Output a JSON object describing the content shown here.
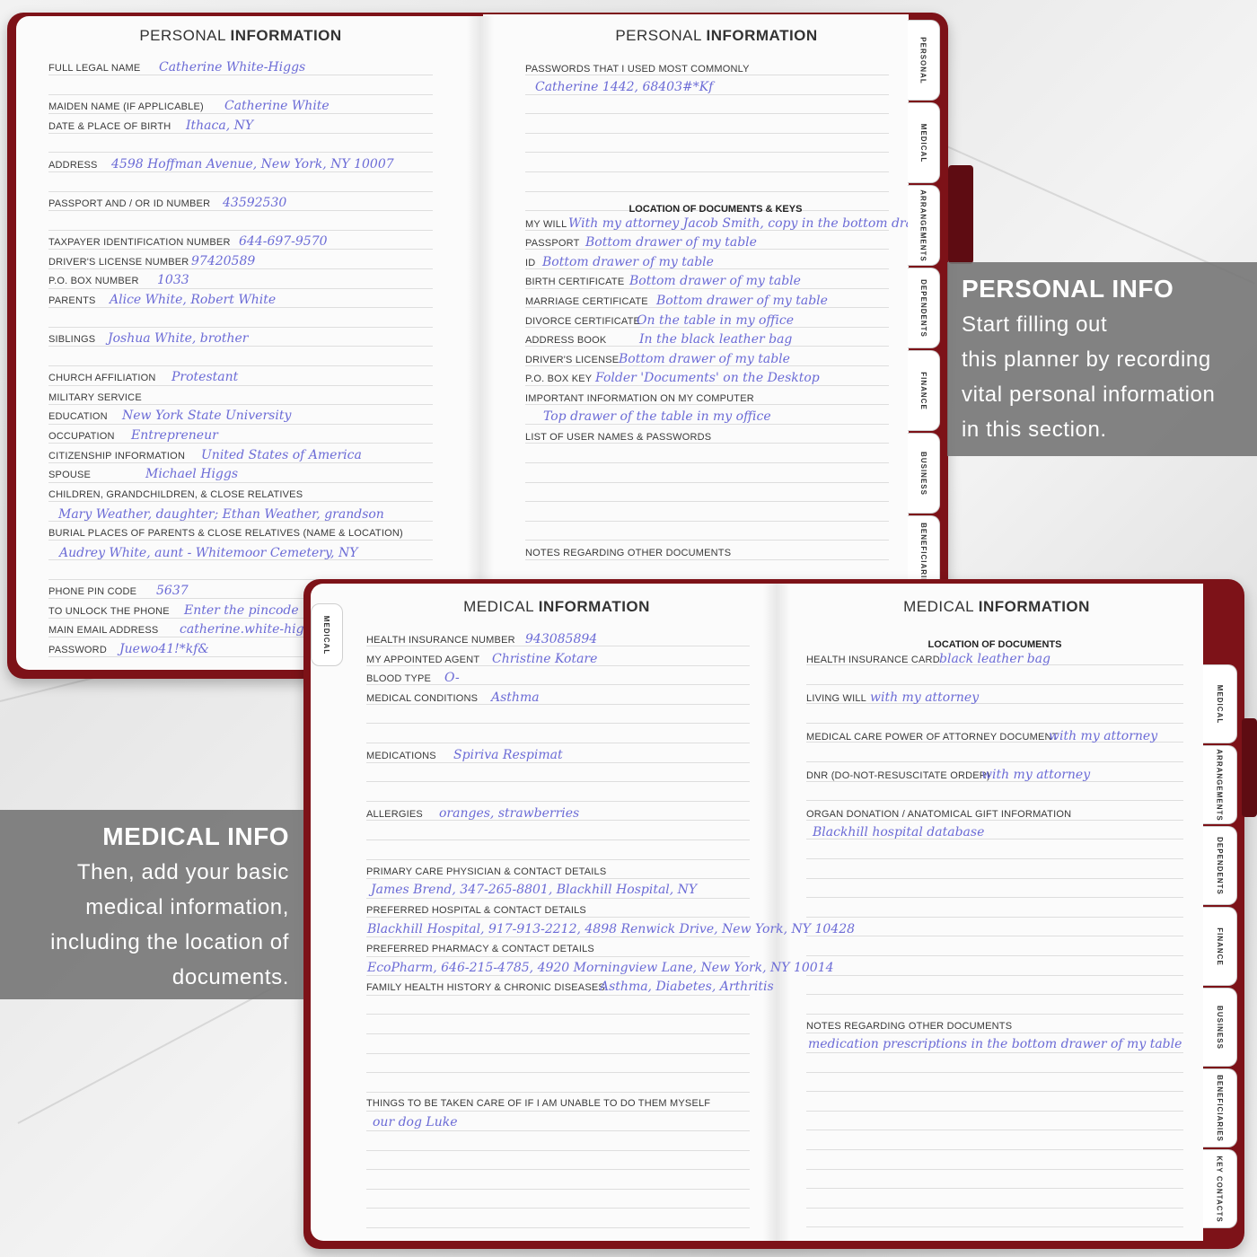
{
  "personal": {
    "title_light": "PERSONAL",
    "title_bold": "INFORMATION",
    "left_rows": [
      {
        "label": "FULL LEGAL NAME",
        "value": "Catherine White-Higgs"
      },
      {
        "label": "MAIDEN NAME (IF APPLICABLE)",
        "value": "Catherine White"
      },
      {
        "label": "DATE & PLACE OF BIRTH",
        "value": "Ithaca, NY"
      },
      {
        "label": "ADDRESS",
        "value": "4598 Hoffman Avenue, New York, NY 10007"
      },
      {
        "label": "PASSPORT AND / OR ID NUMBER",
        "value": "43592530"
      },
      {
        "label": "TAXPAYER IDENTIFICATION NUMBER",
        "value": "644-697-9570"
      },
      {
        "label": "DRIVER'S LICENSE NUMBER",
        "value": "97420589"
      },
      {
        "label": "P.O. BOX NUMBER",
        "value": "1033"
      },
      {
        "label": "PARENTS",
        "value": "Alice White, Robert White"
      },
      {
        "label": "SIBLINGS",
        "value": "Joshua White, brother"
      },
      {
        "label": "CHURCH AFFILIATION",
        "value": "Protestant"
      },
      {
        "label": "MILITARY SERVICE",
        "value": ""
      },
      {
        "label": "EDUCATION",
        "value": "New York State University"
      },
      {
        "label": "OCCUPATION",
        "value": "Entrepreneur"
      },
      {
        "label": "CITIZENSHIP INFORMATION",
        "value": "United States of America"
      },
      {
        "label": "SPOUSE",
        "value": "Michael Higgs"
      },
      {
        "label": "CHILDREN, GRANDCHILDREN, & CLOSE RELATIVES",
        "value": "Mary Weather, daughter; Ethan Weather, grandson"
      },
      {
        "label": "BURIAL PLACES OF PARENTS & CLOSE RELATIVES (NAME & LOCATION)",
        "value": "Audrey White, aunt - Whitemoor Cemetery, NY"
      },
      {
        "label": "PHONE PIN CODE",
        "value": "5637"
      },
      {
        "label": "TO UNLOCK THE PHONE",
        "value": "Enter the pincode"
      },
      {
        "label": "MAIN EMAIL ADDRESS",
        "value": "catherine.white-higgs@"
      },
      {
        "label": "PASSWORD",
        "value": "Juewo41!*kf&"
      }
    ],
    "right_rows": [
      {
        "label": "PASSWORDS THAT I USED MOST COMMONLY",
        "value": "Catherine 1442, 68403#*Kf"
      },
      {
        "label": "MY WILL",
        "value": "With my attorney Jacob Smith, copy in the bottom drawer"
      },
      {
        "label": "PASSPORT",
        "value": "Bottom drawer of my table"
      },
      {
        "label": "ID",
        "value": "Bottom drawer of my table"
      },
      {
        "label": "BIRTH CERTIFICATE",
        "value": "Bottom drawer of my table"
      },
      {
        "label": "MARRIAGE CERTIFICATE",
        "value": "Bottom drawer of my table"
      },
      {
        "label": "DIVORCE CERTIFICATE",
        "value": "On the table in my office"
      },
      {
        "label": "ADDRESS BOOK",
        "value": "In the black leather bag"
      },
      {
        "label": "DRIVER'S LICENSE",
        "value": "Bottom drawer of my table"
      },
      {
        "label": "P.O. BOX KEY",
        "value": "Folder 'Documents' on the Desktop"
      },
      {
        "label": "IMPORTANT INFORMATION ON MY COMPUTER",
        "value": "Top drawer of the table in my office"
      },
      {
        "label": "LIST OF USER NAMES & PASSWORDS",
        "value": ""
      },
      {
        "label": "NOTES REGARDING OTHER DOCUMENTS",
        "value": ""
      }
    ],
    "right_subheading": "LOCATION OF DOCUMENTS & KEYS",
    "tabs": [
      "PERSONAL",
      "MEDICAL",
      "ARRANGEMENTS",
      "DEPENDENTS",
      "FINANCE",
      "BUSINESS",
      "BENEFICIARIES"
    ]
  },
  "medical": {
    "title_light": "MEDICAL",
    "title_bold": "INFORMATION",
    "left_tab": "MEDICAL",
    "left_rows": [
      {
        "label": "HEALTH INSURANCE NUMBER",
        "value": "943085894"
      },
      {
        "label": "MY APPOINTED AGENT",
        "value": "Christine Kotare"
      },
      {
        "label": "BLOOD TYPE",
        "value": "O-"
      },
      {
        "label": "MEDICAL CONDITIONS",
        "value": "Asthma"
      },
      {
        "label": "MEDICATIONS",
        "value": "Spiriva Respimat"
      },
      {
        "label": "ALLERGIES",
        "value": "oranges, strawberries"
      },
      {
        "label": "PRIMARY CARE PHYSICIAN & CONTACT DETAILS",
        "value": "James Brend, 347-265-8801, Blackhill Hospital, NY"
      },
      {
        "label": "PREFERRED HOSPITAL & CONTACT DETAILS",
        "value": "Blackhill Hospital, 917-913-2212, 4898 Renwick Drive, New York, NY 10428"
      },
      {
        "label": "PREFERRED PHARMACY & CONTACT DETAILS",
        "value": "EcoPharm, 646-215-4785, 4920 Morningview Lane, New York, NY 10014"
      },
      {
        "label": "FAMILY HEALTH HISTORY & CHRONIC DISEASES",
        "value": "Asthma, Diabetes, Arthritis"
      },
      {
        "label": "THINGS TO BE TAKEN CARE OF IF I AM UNABLE TO DO THEM MYSELF",
        "value": "our dog Luke"
      }
    ],
    "right_subheading": "LOCATION OF DOCUMENTS",
    "right_rows": [
      {
        "label": "HEALTH INSURANCE CARD",
        "value": "black leather bag"
      },
      {
        "label": "LIVING WILL",
        "value": "with my attorney"
      },
      {
        "label": "MEDICAL CARE POWER OF ATTORNEY DOCUMENT",
        "value": "with my attorney"
      },
      {
        "label": "DNR (DO-NOT-RESUSCITATE ORDER)",
        "value": "with my attorney"
      },
      {
        "label": "ORGAN DONATION / ANATOMICAL GIFT INFORMATION",
        "value": "Blackhill hospital database"
      },
      {
        "label": "NOTES REGARDING OTHER DOCUMENTS",
        "value": "medication prescriptions in the bottom drawer of my table"
      }
    ],
    "tabs": [
      "MEDICAL",
      "ARRANGEMENTS",
      "DEPENDENTS",
      "FINANCE",
      "BUSINESS",
      "BENEFICIARIES",
      "KEY CONTACTS"
    ]
  },
  "callouts": {
    "personal": {
      "heading": "PERSONAL INFO",
      "lines": [
        "Start filling out",
        "this planner by recording",
        "vital personal information",
        "in this section."
      ]
    },
    "medical": {
      "heading": "MEDICAL INFO",
      "lines": [
        "Then, add your basic",
        "medical information,",
        "including the location of",
        "documents."
      ]
    }
  },
  "colors": {
    "cover": "#7d1218",
    "handwriting": "#6b6bd6",
    "callout": "#767676"
  }
}
